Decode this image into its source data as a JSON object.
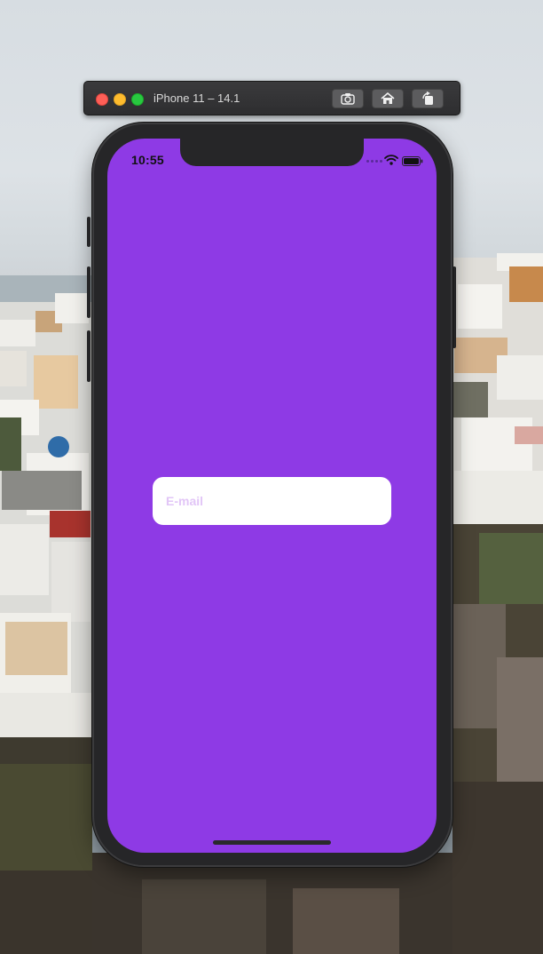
{
  "simulator": {
    "window_title": "iPhone 11 – 14.1",
    "toolbar": {
      "screenshot_icon": "camera-icon",
      "home_icon": "house-icon",
      "rotate_icon": "rotate-icon"
    }
  },
  "status_bar": {
    "time": "10:55",
    "wifi_icon": "wifi-icon",
    "battery_icon": "battery-icon"
  },
  "form": {
    "email": {
      "placeholder": "E-mail",
      "value": ""
    }
  },
  "colors": {
    "screen_background": "#8e3ae5",
    "input_background": "#ffffff",
    "placeholder_text": "#e2c6f7"
  }
}
